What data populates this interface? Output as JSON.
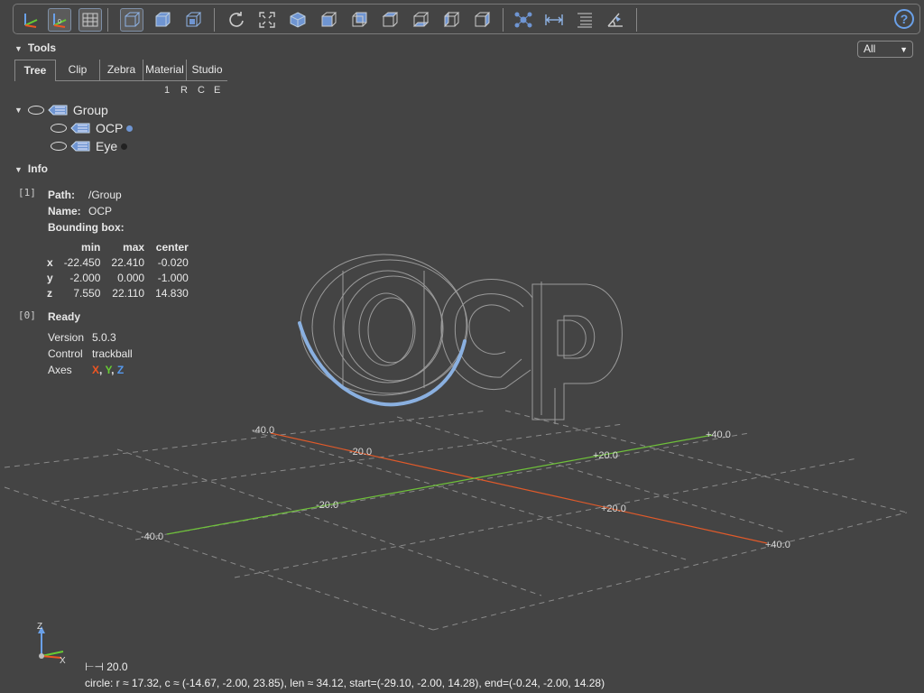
{
  "toolbar": {
    "buttons": [
      "axes",
      "axes-origin",
      "grid",
      "perspective",
      "ortho-front-iso",
      "ortho-iso-2",
      "reset-view",
      "fit-view",
      "iso-view",
      "front-view",
      "rear-view",
      "top-view",
      "bottom-view",
      "left-view",
      "right-view",
      "explode",
      "measure-distance",
      "measure-properties",
      "measure-angle"
    ],
    "help": "?"
  },
  "filter": {
    "value": "All"
  },
  "tools": {
    "title": "Tools",
    "tabs": [
      "Tree",
      "Clip",
      "Zebra",
      "Material",
      "Studio"
    ],
    "tree_flags": [
      "1",
      "R",
      "C",
      "E"
    ]
  },
  "tree": {
    "group": "Group",
    "children": [
      {
        "label": "OCP",
        "dot_color": "#6f95d2"
      },
      {
        "label": "Eye",
        "dot_color": "#222222"
      }
    ]
  },
  "info": {
    "title": "Info",
    "index1": "[1]",
    "path_label": "Path:",
    "path_value": "/Group",
    "name_label": "Name:",
    "name_value": "OCP",
    "bbox_label": "Bounding box:",
    "bbox_headers": [
      "min",
      "max",
      "center"
    ],
    "bbox_rows": [
      {
        "axis": "x",
        "min": "-22.450",
        "max": "22.410",
        "center": "-0.020"
      },
      {
        "axis": "y",
        "min": "-2.000",
        "max": "0.000",
        "center": "-1.000"
      },
      {
        "axis": "z",
        "min": "7.550",
        "max": "22.110",
        "center": "14.830"
      }
    ],
    "index0": "[0]",
    "ready": "Ready",
    "version_label": "Version",
    "version_value": "5.0.3",
    "control_label": "Control",
    "control_value": "trackball",
    "axes_label": "Axes",
    "axes_x": "X",
    "axes_y": "Y",
    "axes_z": "Z",
    "colors": {
      "x": "#ee5522",
      "y": "#66cc33",
      "z": "#5599ee"
    }
  },
  "viewport": {
    "grid_labels": [
      {
        "text": "-40.0"
      },
      {
        "text": "-20.0"
      },
      {
        "text": "+20.0"
      },
      {
        "text": "+40.0"
      },
      {
        "text": "-40.0"
      },
      {
        "text": "-20.0"
      },
      {
        "text": "+20.0"
      },
      {
        "text": "+40.0"
      }
    ],
    "triad": {
      "z": "Z",
      "x": "X"
    }
  },
  "status": {
    "scale": "⊢⊣ 20.0",
    "measure": "circle: r ≈ 17.32, c ≈ (-14.67, -2.00, 23.85), len ≈ 34.12, start=(-29.10, -2.00, 14.28), end=(-0.24, -2.00, 14.28)"
  }
}
